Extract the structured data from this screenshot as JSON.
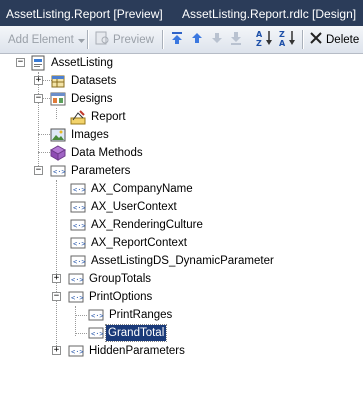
{
  "tabs": [
    {
      "label": "AssetListing.Report [Preview]"
    },
    {
      "label": "AssetListing.Report.rdlc [Design]"
    }
  ],
  "toolbar": {
    "add_element": "Add Element",
    "preview": "Preview",
    "delete": "Delete"
  },
  "tree": {
    "root": "AssetListing",
    "datasets": "Datasets",
    "designs": "Designs",
    "report": "Report",
    "images": "Images",
    "data_methods": "Data Methods",
    "parameters": "Parameters",
    "params": [
      "AX_CompanyName",
      "AX_UserContext",
      "AX_RenderingCulture",
      "AX_ReportContext",
      "AssetListingDS_DynamicParameter"
    ],
    "group_totals": "GroupTotals",
    "print_options": "PrintOptions",
    "print_ranges": "PrintRanges",
    "grand_total": "GrandTotal",
    "hidden_parameters": "HiddenParameters"
  },
  "colors": {
    "tab_strip": "#2b3c59",
    "selection": "#1a3a79"
  }
}
